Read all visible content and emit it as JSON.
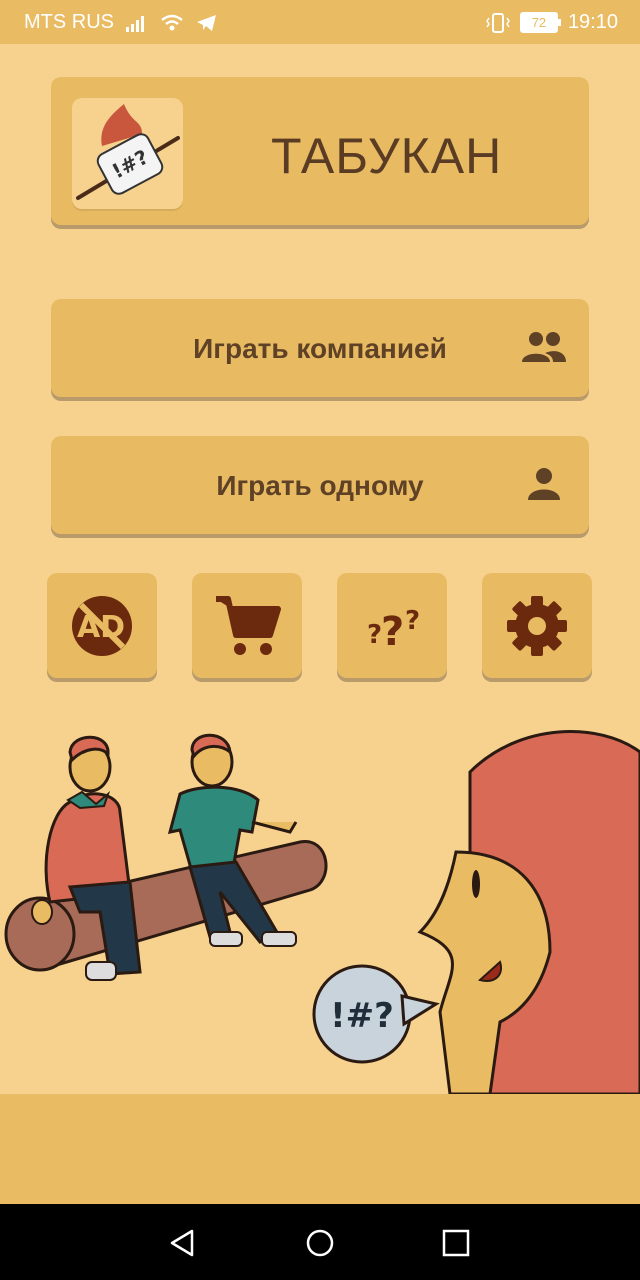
{
  "status_bar": {
    "carrier": "MTS RUS",
    "battery": "72",
    "time": "19:10"
  },
  "header": {
    "app_title": "ТАБУКАН",
    "logo_text": "!#?"
  },
  "menu": {
    "play_group_label": "Играть компанией",
    "play_solo_label": "Играть одному"
  },
  "quick_actions": [
    {
      "icon": "no-ads-icon"
    },
    {
      "icon": "cart-icon"
    },
    {
      "icon": "help-icon"
    },
    {
      "icon": "settings-icon"
    }
  ],
  "illustration": {
    "speech_bubble_text": "!#?"
  },
  "colors": {
    "background": "#f6d28e",
    "card": "#e8bb63",
    "text": "#5f4126",
    "icon": "#6b2a0e"
  }
}
